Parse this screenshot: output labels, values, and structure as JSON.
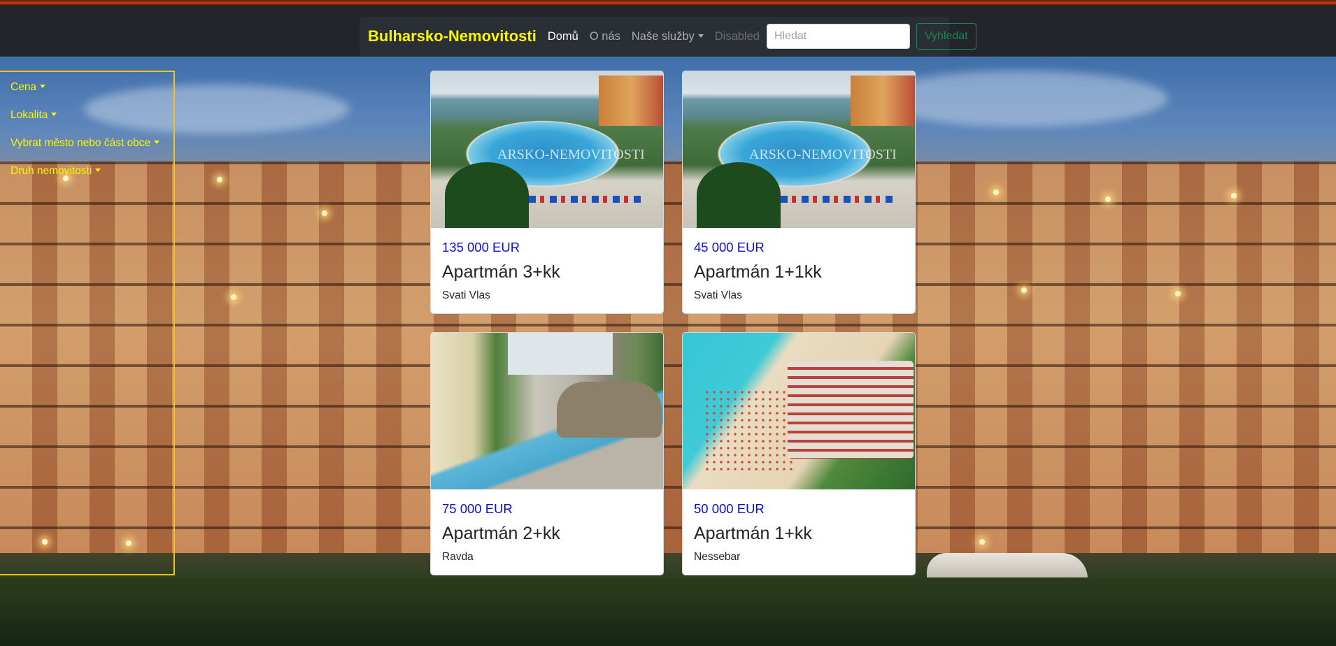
{
  "navbar": {
    "brand": "Bulharsko-Nemovitosti",
    "links": [
      {
        "label": "Domů",
        "active": true
      },
      {
        "label": "O nás"
      },
      {
        "label": "Naše služby",
        "dropdown": true
      },
      {
        "label": "Disabled",
        "disabled": true
      }
    ],
    "search": {
      "placeholder": "Hledat",
      "value": ""
    },
    "search_button": "Vyhledat"
  },
  "filters": [
    {
      "label": "Cena"
    },
    {
      "label": "Lokalita"
    },
    {
      "label": "Vybrat město nebo část obce"
    },
    {
      "label": "Druh nemovitosti"
    }
  ],
  "listings": [
    {
      "price": "135 000 EUR",
      "title": "Apartmán 3+kk",
      "location": "Svati Vlas",
      "image": "pool-resort-photo",
      "watermark": "ARSKO-NEMOVITOSTI"
    },
    {
      "price": "45 000 EUR",
      "title": "Apartmán 1+1kk",
      "location": "Svati Vlas",
      "image": "pool-resort-photo",
      "watermark": "ARSKO-NEMOVITOSTI"
    },
    {
      "price": "75 000 EUR",
      "title": "Apartmán 2+kk",
      "location": "Ravda",
      "image": "apartment-pool-photo"
    },
    {
      "price": "50 000 EUR",
      "title": "Apartmán 1+kk",
      "location": "Nessebar",
      "image": "beach-resort-photo"
    }
  ],
  "colors": {
    "brand": "#f7f700",
    "price": "#0d0dd4",
    "filter_border": "#f0c419",
    "search_button": "#198754"
  }
}
